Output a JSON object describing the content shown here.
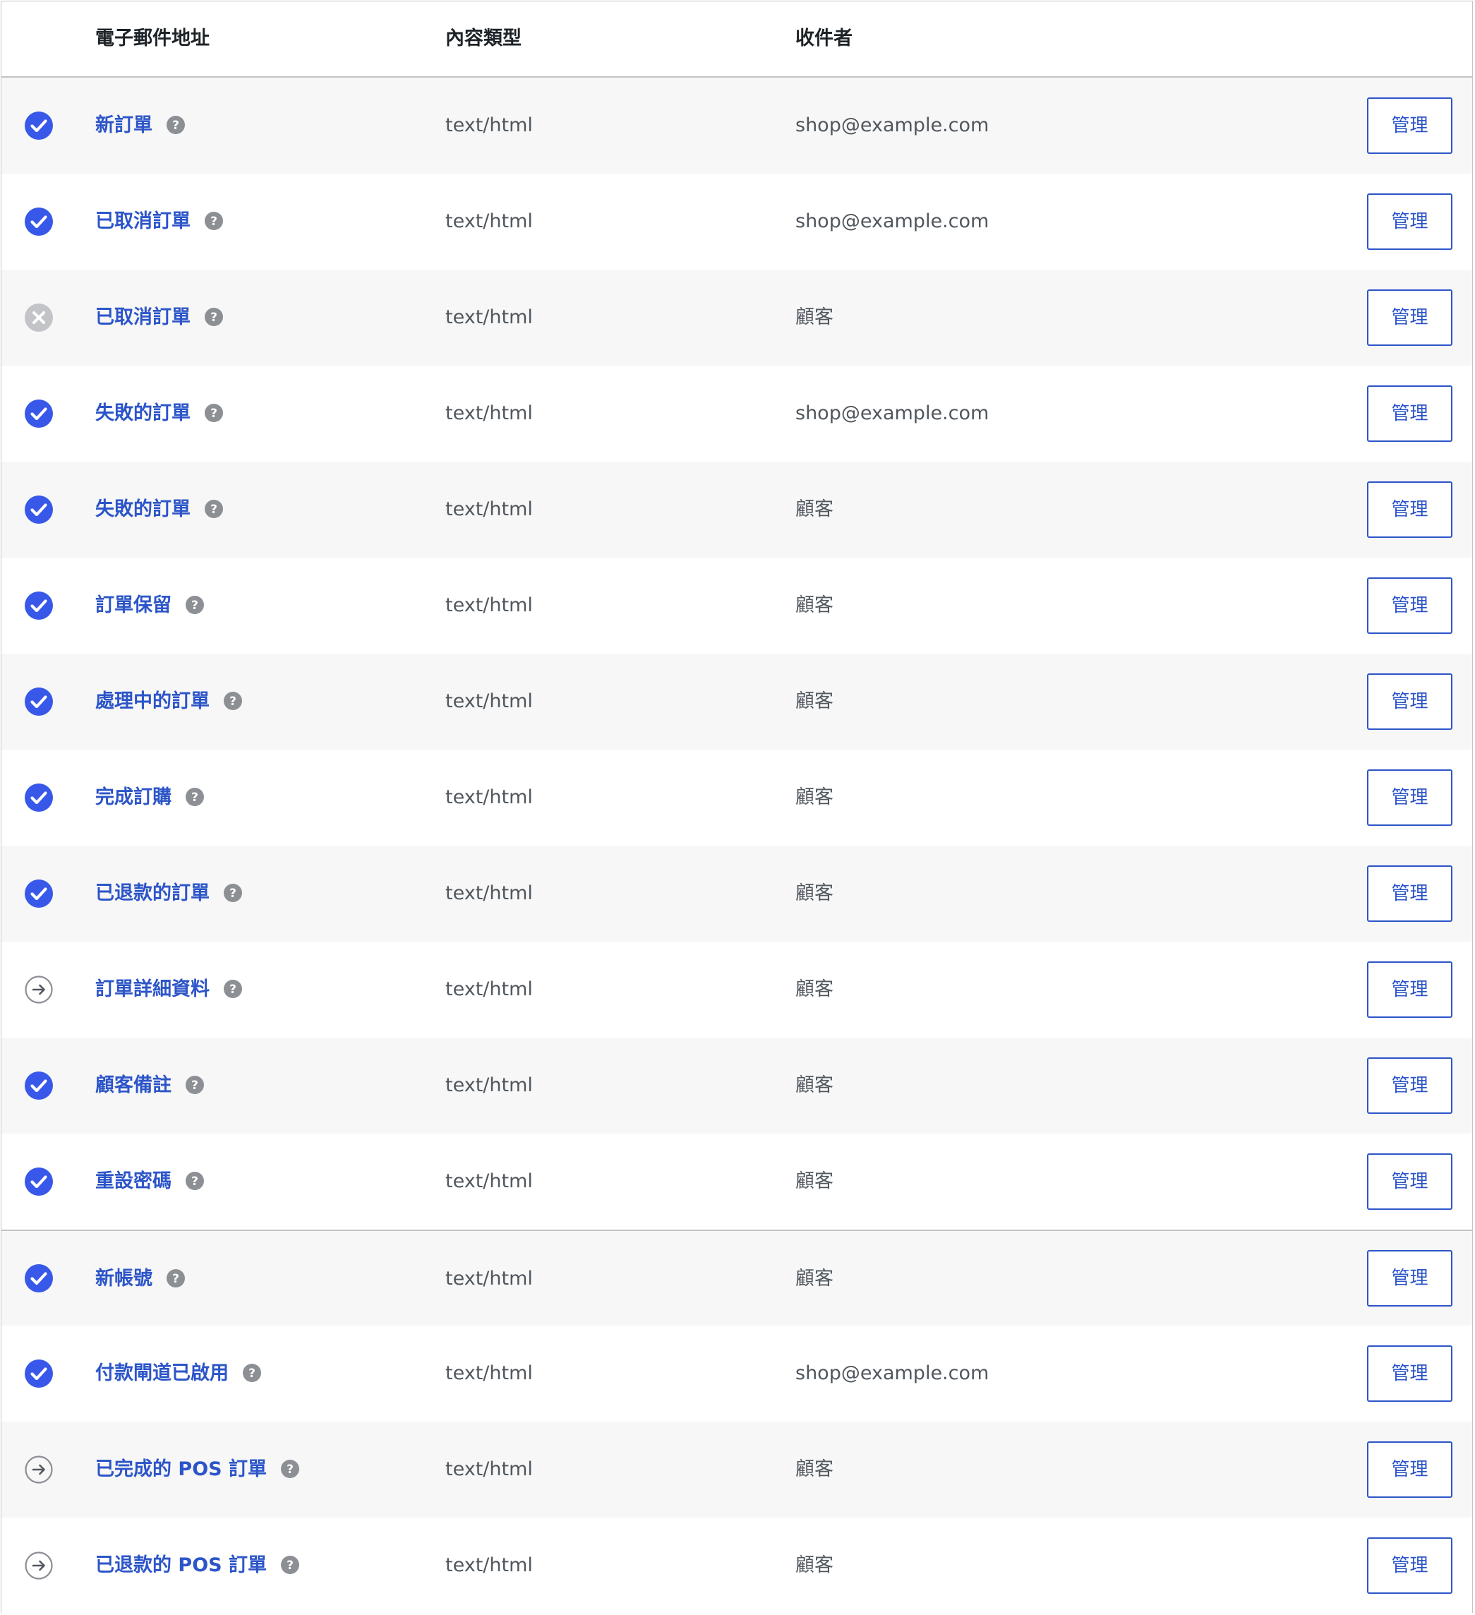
{
  "colors": {
    "accent": "#2c55c8",
    "enabled_check": "#3858e9",
    "disabled_icon": "#c3c4c7",
    "manual_icon": "#8c8f94",
    "help_icon": "#8c8f94",
    "row_alt_bg": "#f7f7f7"
  },
  "table": {
    "headers": {
      "name": "電子郵件地址",
      "content_type": "內容類型",
      "recipient": "收件者"
    },
    "rows": [
      {
        "status": "enabled",
        "name": "新訂單",
        "content_type": "text/html",
        "recipient": "shop@example.com",
        "action": "管理"
      },
      {
        "status": "enabled",
        "name": "已取消訂單",
        "content_type": "text/html",
        "recipient": "shop@example.com",
        "action": "管理"
      },
      {
        "status": "disabled",
        "name": "已取消訂單",
        "content_type": "text/html",
        "recipient": "顧客",
        "action": "管理"
      },
      {
        "status": "enabled",
        "name": "失敗的訂單",
        "content_type": "text/html",
        "recipient": "shop@example.com",
        "action": "管理"
      },
      {
        "status": "enabled",
        "name": "失敗的訂單",
        "content_type": "text/html",
        "recipient": "顧客",
        "action": "管理"
      },
      {
        "status": "enabled",
        "name": "訂單保留",
        "content_type": "text/html",
        "recipient": "顧客",
        "action": "管理"
      },
      {
        "status": "enabled",
        "name": "處理中的訂單",
        "content_type": "text/html",
        "recipient": "顧客",
        "action": "管理"
      },
      {
        "status": "enabled",
        "name": "完成訂購",
        "content_type": "text/html",
        "recipient": "顧客",
        "action": "管理"
      },
      {
        "status": "enabled",
        "name": "已退款的訂單",
        "content_type": "text/html",
        "recipient": "顧客",
        "action": "管理"
      },
      {
        "status": "manual",
        "name": "訂單詳細資料",
        "content_type": "text/html",
        "recipient": "顧客",
        "action": "管理"
      },
      {
        "status": "enabled",
        "name": "顧客備註",
        "content_type": "text/html",
        "recipient": "顧客",
        "action": "管理"
      },
      {
        "status": "enabled",
        "name": "重設密碼",
        "content_type": "text/html",
        "recipient": "顧客",
        "action": "管理"
      },
      {
        "status": "enabled",
        "name": "新帳號",
        "content_type": "text/html",
        "recipient": "顧客",
        "action": "管理"
      },
      {
        "status": "enabled",
        "name": "付款閘道已啟用",
        "content_type": "text/html",
        "recipient": "shop@example.com",
        "action": "管理"
      },
      {
        "status": "manual",
        "name": "已完成的 POS 訂單",
        "content_type": "text/html",
        "recipient": "顧客",
        "action": "管理"
      },
      {
        "status": "manual",
        "name": "已退款的 POS 訂單",
        "content_type": "text/html",
        "recipient": "顧客",
        "action": "管理"
      }
    ]
  }
}
